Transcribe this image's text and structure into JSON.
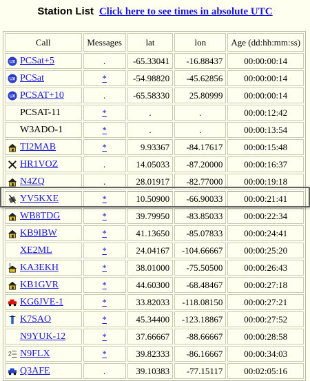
{
  "header": {
    "title": "Station List",
    "utc_link": "Click here to see times in absolute UTC"
  },
  "columns": [
    "Call",
    "Messages",
    "lat",
    "lon",
    "Age (dd:hh:mm:ss)"
  ],
  "rows": [
    {
      "call": "PCSat+5",
      "icon": "satellite-icon",
      "link": true,
      "msg": ".",
      "lat": "-65.33041",
      "lon": "-16.88437",
      "age": "00:00:00:14"
    },
    {
      "call": "PCSat",
      "icon": "satellite-icon",
      "link": true,
      "msg": "*",
      "lat": "-54.98820",
      "lon": "-45.62856",
      "age": "00:00:00:14"
    },
    {
      "call": "PCSAT+10",
      "icon": "satellite-icon",
      "link": true,
      "msg": ".",
      "lat": "-65.58330",
      "lon": "25.80999",
      "age": "00:00:00:14"
    },
    {
      "call": "PCSAT-11",
      "icon": "",
      "link": false,
      "msg": "*",
      "lat": ".",
      "lon": ".",
      "age": "00:00:12:42"
    },
    {
      "call": "W3ADO-1",
      "icon": "",
      "link": false,
      "msg": "*",
      "lat": ".",
      "lon": ".",
      "age": "00:00:13:54"
    },
    {
      "call": "TI2MAB",
      "icon": "house-icon",
      "link": true,
      "msg": "*",
      "lat": "9.93367",
      "lon": "-84.17617",
      "age": "00:00:15:48"
    },
    {
      "call": "HR1VOZ",
      "icon": "cross-icon",
      "link": true,
      "msg": ".",
      "lat": "14.05033",
      "lon": "-87.20000",
      "age": "00:00:16:37"
    },
    {
      "call": "N4ZQ",
      "icon": "house-icon",
      "link": true,
      "msg": ".",
      "lat": "28.01917",
      "lon": "-82.77000",
      "age": "00:00:19:18"
    },
    {
      "call": "YV5KXE",
      "icon": "phone-icon",
      "link": true,
      "msg": "*",
      "lat": "10.50900",
      "lon": "-66.90033",
      "age": "00:00:21:41"
    },
    {
      "call": "WB8TDG",
      "icon": "house-icon",
      "link": true,
      "msg": "*",
      "lat": "39.79950",
      "lon": "-83.85033",
      "age": "00:00:22:34"
    },
    {
      "call": "KB9IBW",
      "icon": "house-icon",
      "link": true,
      "msg": "*",
      "lat": "41.13650",
      "lon": "-85.07833",
      "age": "00:00:24:41"
    },
    {
      "call": "XE2ML",
      "icon": "",
      "link": true,
      "msg": "*",
      "lat": "24.04167",
      "lon": "-104.66667",
      "age": "00:00:25:20"
    },
    {
      "call": "KA3EKH",
      "icon": "house-antenna-icon",
      "link": true,
      "msg": "*",
      "lat": "38.01000",
      "lon": "-75.50500",
      "age": "00:00:26:43"
    },
    {
      "call": "KB1GVR",
      "icon": "house-icon",
      "link": true,
      "msg": "*",
      "lat": "44.60300",
      "lon": "-68.48467",
      "age": "00:00:27:18"
    },
    {
      "call": "KG6JVE-1",
      "icon": "car-icon",
      "link": true,
      "msg": "*",
      "lat": "33.82033",
      "lon": "-118.08150",
      "age": "00:00:27:21"
    },
    {
      "call": "K7SAO",
      "icon": "antenna-icon",
      "link": true,
      "msg": "*",
      "lat": "45.34400",
      "lon": "-123.18867",
      "age": "00:00:27:52"
    },
    {
      "call": "N9YUK-12",
      "icon": "",
      "link": true,
      "msg": "*",
      "lat": "37.66667",
      "lon": "-88.66667",
      "age": "00:00:28:58"
    },
    {
      "call": "N9FLX",
      "icon": "digi-icon",
      "link": true,
      "msg": "*",
      "lat": "39.82333",
      "lon": "-86.16667",
      "age": "00:00:34:03"
    },
    {
      "call": "Q3AFE",
      "icon": "car-blue-icon",
      "link": true,
      "msg": ".",
      "lat": "39.10383",
      "lon": "-77.15117",
      "age": "00:02:05:16"
    }
  ],
  "highlighted_call": "YV5KXE",
  "colors": {
    "link": "#1a16d6",
    "background": "#fffff0"
  }
}
